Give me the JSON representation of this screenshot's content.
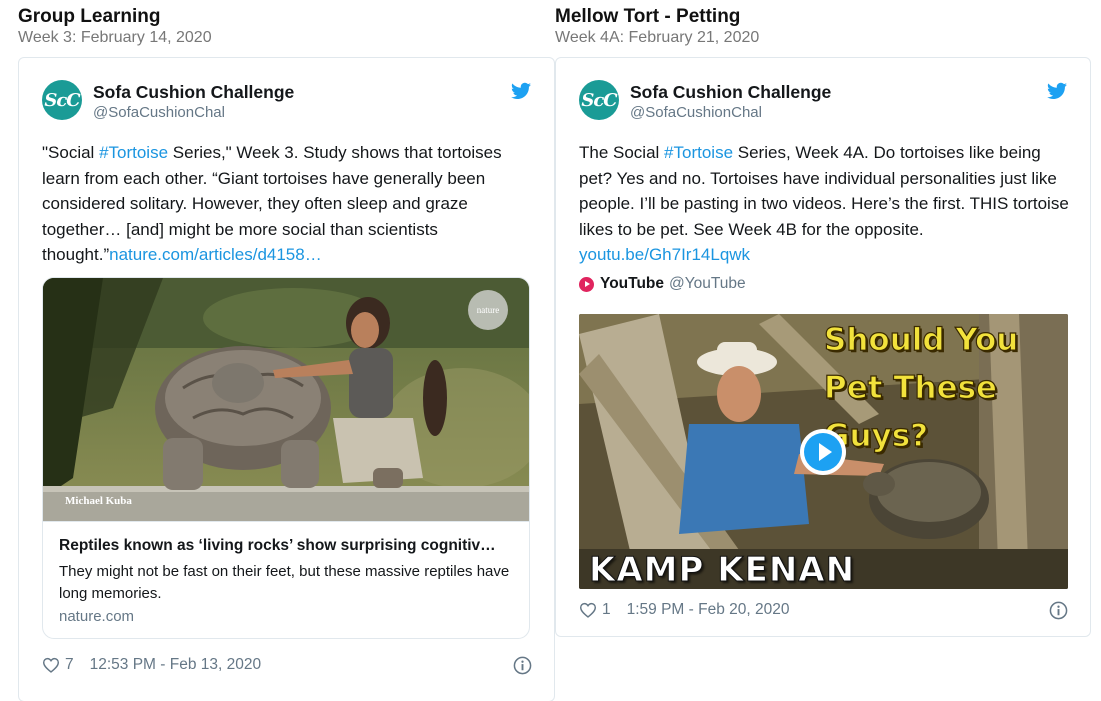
{
  "left": {
    "title": "Group Learning",
    "date": "Week 3: February 14, 2020",
    "tweet": {
      "avatar_text": "ScC",
      "name": "Sofa Cushion Challenge",
      "handle": "@SofaCushionChal",
      "text_part1": "\"Social ",
      "hashtag": "#Tortoise",
      "text_part2": " Series,\" Week 3. Study shows that tortoises learn from each other. “Giant tortoises have generally been considered solitary. However, they often sleep and graze together… [and] might be more social than scientists thought.”",
      "link": "nature.com/articles/d4158…",
      "card": {
        "image_credit": "Michael Kuba",
        "image_badge": "nature",
        "title": "Reptiles known as ‘living rocks’ show surprising cognitiv…",
        "description": "They might not be fast on their feet, but these massive reptiles have long memories.",
        "domain": "nature.com"
      },
      "likes": "7",
      "timestamp": "12:53 PM - Feb 13, 2020"
    }
  },
  "right": {
    "title": "Mellow Tort - Petting",
    "date": "Week 4A: February 21, 2020",
    "tweet": {
      "avatar_text": "ScC",
      "name": "Sofa Cushion Challenge",
      "handle": "@SofaCushionChal",
      "text_part1": "The Social ",
      "hashtag": "#Tortoise",
      "text_part2": " Series, Week 4A.  Do tortoises like being pet?  Yes and no.  Tortoises have individual personalities just like people.  I’ll be pasting in two videos.  Here’s the first.  THIS tortoise likes to be pet.  See Week 4B for the opposite. ",
      "link": "youtu.be/Gh7Ir14Lqwk",
      "source_name": "YouTube",
      "source_handle": "@YouTube",
      "video": {
        "caption": "Should You Pet These Guys?",
        "brand": "KAMP KENAN"
      },
      "likes": "1",
      "timestamp": "1:59 PM - Feb 20, 2020"
    }
  },
  "colors": {
    "link": "#1b95e0",
    "avatar": "#1a9b96",
    "twitter_blue": "#1da1f2",
    "muted": "#657786"
  },
  "icons": [
    "twitter-bird-icon",
    "heart-icon",
    "info-icon",
    "youtube-icon",
    "play-icon"
  ]
}
